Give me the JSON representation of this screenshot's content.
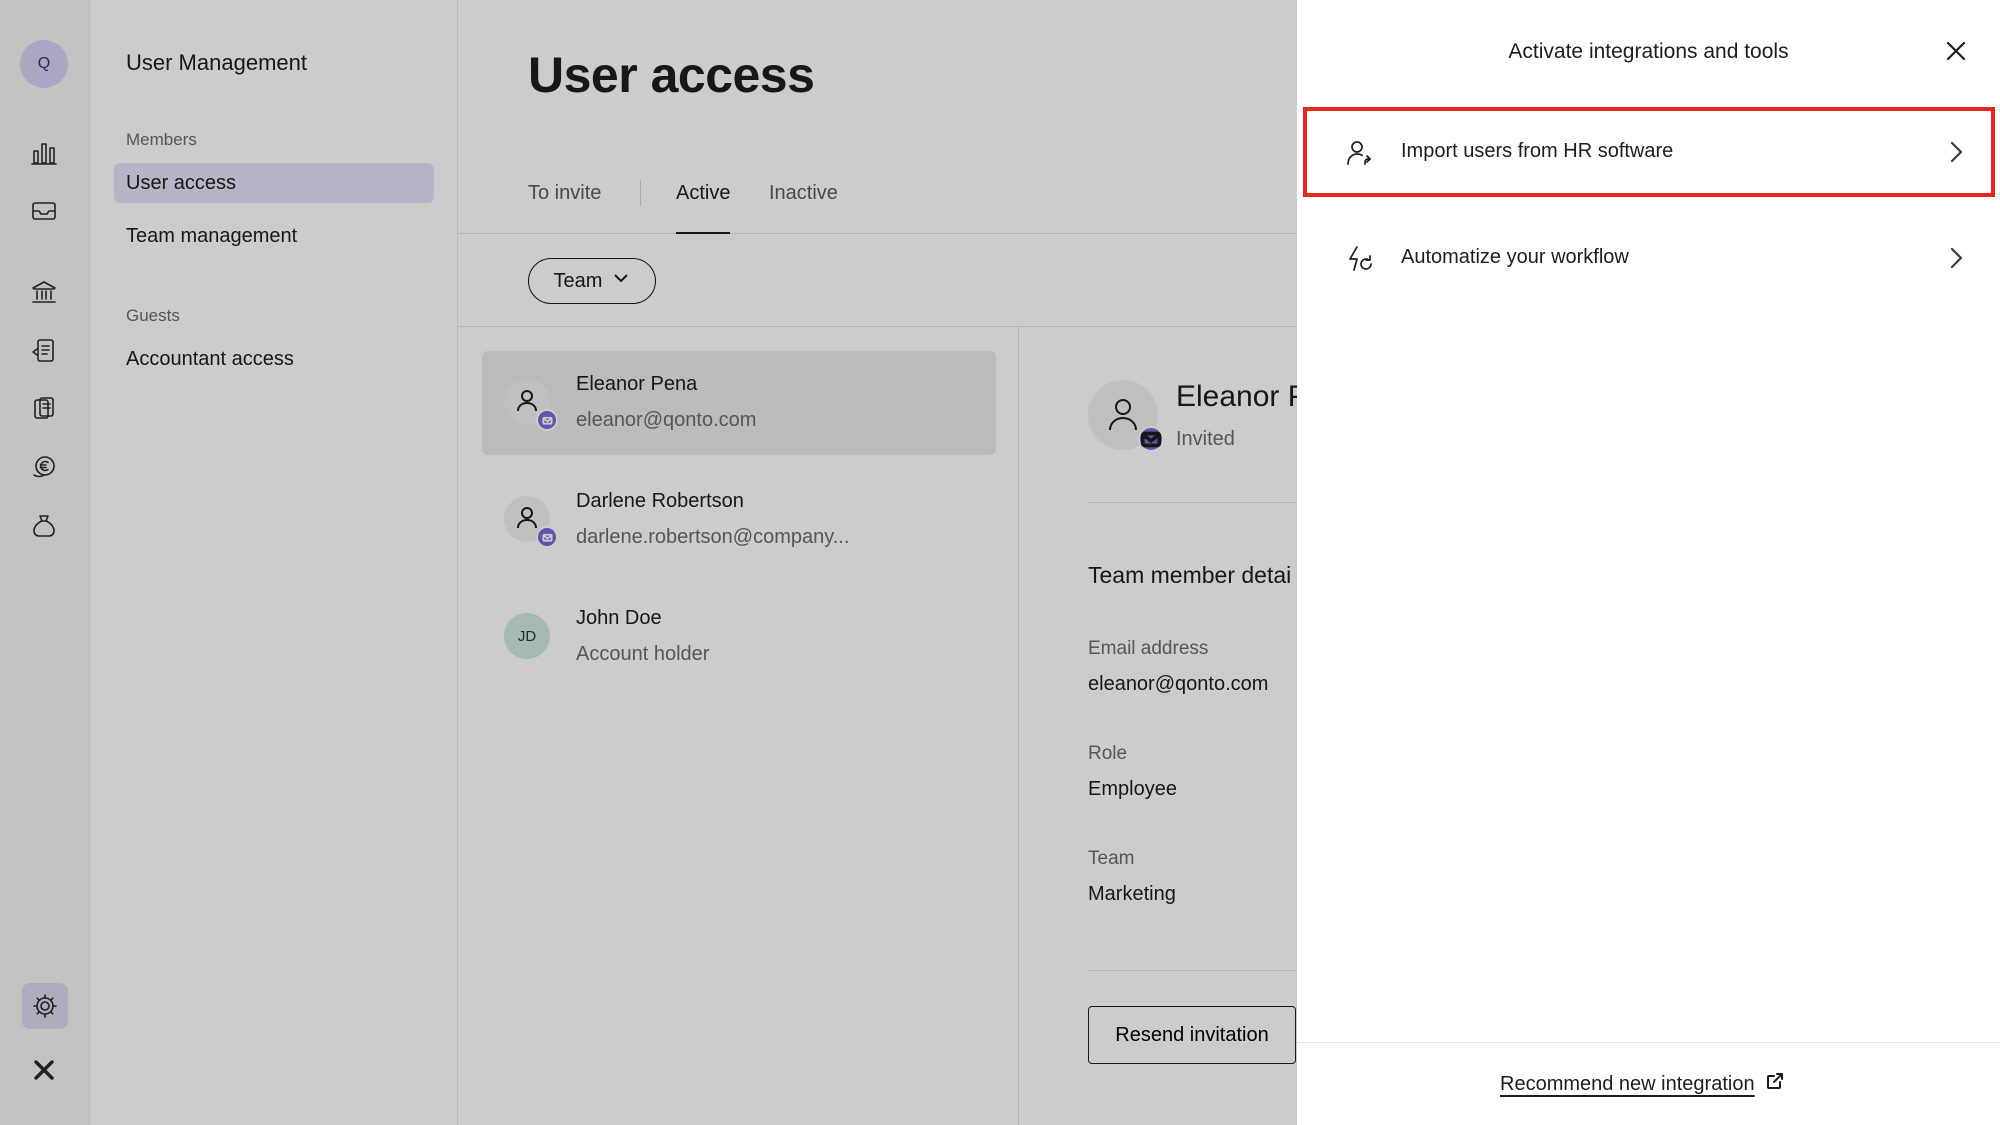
{
  "rail": {
    "avatar_initial": "Q",
    "icons": [
      "chart-icon",
      "inbox-icon",
      "bank-icon",
      "invoice-icon",
      "documents-icon",
      "euro-icon",
      "savings-icon",
      "settings-icon",
      "logo-icon"
    ]
  },
  "nav": {
    "title": "User Management",
    "sections": [
      {
        "label": "Members",
        "items": [
          {
            "label": "User access",
            "active": true
          },
          {
            "label": "Team management",
            "active": false
          }
        ]
      },
      {
        "label": "Guests",
        "items": [
          {
            "label": "Accountant access",
            "active": false
          }
        ]
      }
    ]
  },
  "main": {
    "title": "User access",
    "tabs": [
      {
        "label": "To invite",
        "active": false
      },
      {
        "label": "Active",
        "active": true
      },
      {
        "label": "Inactive",
        "active": false
      }
    ],
    "filter_label": "Team",
    "members": [
      {
        "name": "Eleanor Pena",
        "subtitle": "eleanor@qonto.com",
        "avatar": "person-icon",
        "invited_badge": true,
        "selected": true
      },
      {
        "name": "Darlene Robertson",
        "subtitle": "darlene.robertson@company...",
        "avatar": "person-icon",
        "invited_badge": true,
        "selected": false
      },
      {
        "name": "John Doe",
        "subtitle": "Account holder",
        "avatar_initials": "JD",
        "invited_badge": false,
        "selected": false
      }
    ]
  },
  "detail": {
    "name": "Eleanor P",
    "status": "Invited",
    "section_title": "Team member detai",
    "fields": [
      {
        "label": "Email address",
        "value": "eleanor@qonto.com"
      },
      {
        "label": "Role",
        "value": "Employee"
      },
      {
        "label": "Team",
        "value": "Marketing"
      }
    ],
    "resend_label": "Resend invitation"
  },
  "drawer": {
    "title": "Activate integrations and tools",
    "items": [
      {
        "label": "Import users from HR software",
        "icon": "person-sync-icon",
        "highlighted": true
      },
      {
        "label": "Automatize your workflow",
        "icon": "lightning-sync-icon",
        "highlighted": false
      }
    ],
    "footer_link": "Recommend new integration"
  },
  "colors": {
    "accent_purple": "#7d67d8",
    "nav_active_bg": "#e6e0f8",
    "highlight_red": "#e8261c",
    "overlay": "rgba(0,0,0,0.20)"
  }
}
